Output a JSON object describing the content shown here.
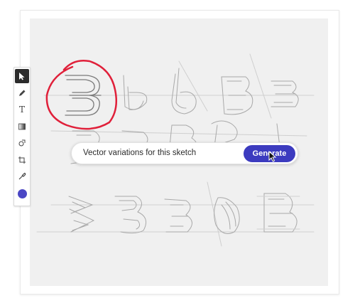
{
  "prompt": {
    "text": "Vector variations for this sketch",
    "generate_label": "Generate"
  },
  "toolbar": {
    "tools": [
      "select-arrow-icon",
      "pen-icon",
      "text-icon",
      "gradient-icon",
      "shape-builder-icon",
      "crop-icon",
      "eyedropper-icon"
    ],
    "text_tool_glyph": "T",
    "active_tool": "select-arrow-icon",
    "fill_color": "#4a46c4"
  },
  "colors": {
    "accent": "#3c3bbf",
    "highlight_circle": "#e0203a",
    "canvas_bg": "#f0f0f0"
  }
}
